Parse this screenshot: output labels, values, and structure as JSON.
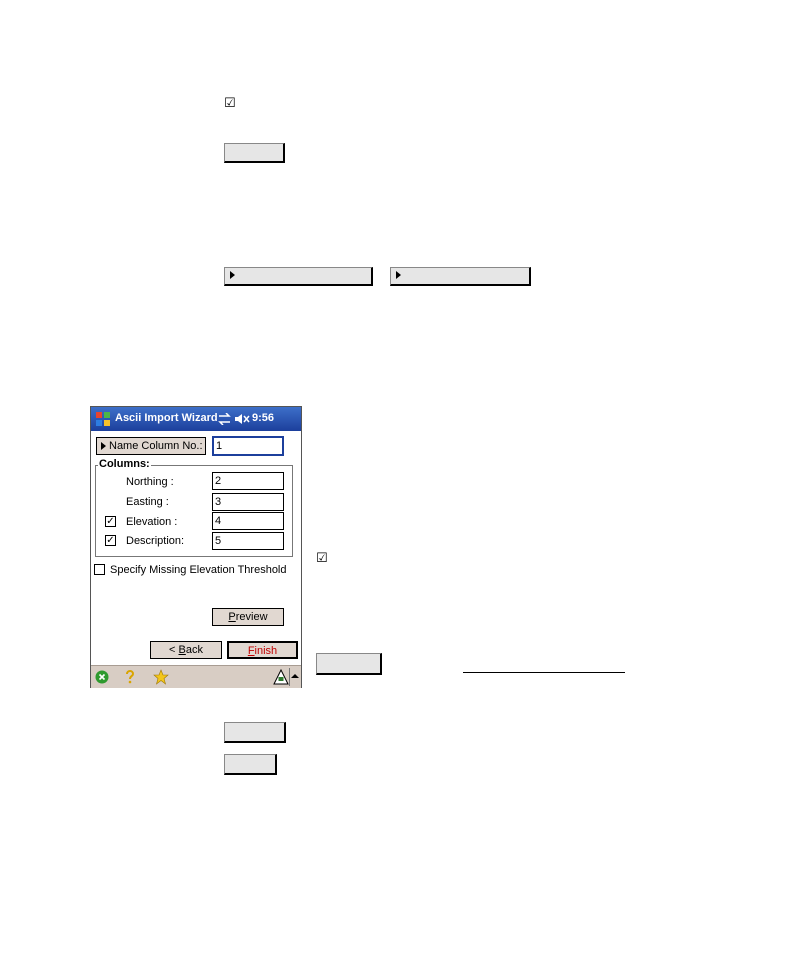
{
  "device": {
    "title_bar": {
      "title": "Ascii Import Wizard",
      "time": "9:56",
      "icons": [
        "windows-flag-icon",
        "connectivity-icon",
        "speaker-muted-icon"
      ]
    },
    "name_column": {
      "label": "Name Column No.:",
      "value": "1"
    },
    "columns_group": {
      "label": "Columns:",
      "rows": [
        {
          "label": "Northing :",
          "value": "2",
          "has_checkbox": false
        },
        {
          "label": "Easting :",
          "value": "3",
          "has_checkbox": false
        },
        {
          "label": "Elevation :",
          "value": "4",
          "has_checkbox": true,
          "checked": true
        },
        {
          "label": "Description:",
          "value": "5",
          "has_checkbox": true,
          "checked": true
        }
      ]
    },
    "missing_elevation": {
      "label": "Specify Missing Elevation Threshold",
      "checked": false
    },
    "buttons": {
      "preview": "Preview",
      "back": "< Back",
      "finish": "Finish"
    },
    "command_bar_icons": [
      "close-icon",
      "help-icon",
      "favorites-icon",
      "input-panel-icon",
      "up-arrow-icon"
    ],
    "colors": {
      "title_bar": "#1c3f9c",
      "finish_text": "#c00000",
      "button_face": "#e1d8d1",
      "command_bar": "#d8cdc4"
    }
  },
  "document_icons": {
    "checkbox_glyph": "☑"
  }
}
